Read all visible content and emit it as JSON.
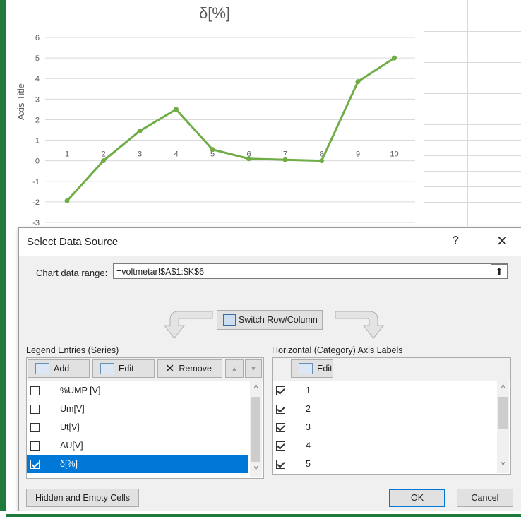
{
  "chart": {
    "title": "δ[%]",
    "axis_title": "Axis Title"
  },
  "chart_data": {
    "type": "line",
    "title": "δ[%]",
    "ylabel": "Axis Title",
    "xlabel": "",
    "categories": [
      "1",
      "2",
      "3",
      "4",
      "5",
      "6",
      "7",
      "8",
      "9",
      "10"
    ],
    "series": [
      {
        "values": [
          -1.95,
          0.0,
          1.45,
          2.5,
          0.55,
          0.1,
          0.05,
          0.0,
          3.85,
          5.0
        ],
        "color": "#70ad47"
      }
    ],
    "y_ticks": [
      "6",
      "5",
      "4",
      "3",
      "2",
      "1",
      "0",
      "-1",
      "-2",
      "-3"
    ],
    "ylim": [
      -3,
      6
    ],
    "grid": true
  },
  "dialog": {
    "title": "Select Data Source",
    "help": "?",
    "close": "✕",
    "chart_range_label": "Chart data range:",
    "chart_range_value": "=voltmetar!$A$1:$K$6",
    "collapse_icon": "⬆",
    "switch_label": "Switch Row/Column",
    "legend_label": "Legend Entries (Series)",
    "axis_labels_label": "Horizontal (Category) Axis Labels",
    "toolbar": {
      "add": "Add",
      "edit": "Edit",
      "remove": "Remove",
      "up": "▲",
      "down": "▼",
      "axis_edit": "Edit"
    },
    "series": [
      {
        "label": "%UMP [V]",
        "checked": false
      },
      {
        "label": "Um[V]",
        "checked": false
      },
      {
        "label": "Ut[V]",
        "checked": false
      },
      {
        "label": "ΔU[V]",
        "checked": false
      },
      {
        "label": "δ[%]",
        "checked": true
      }
    ],
    "categories": [
      {
        "label": "1",
        "checked": true
      },
      {
        "label": "2",
        "checked": true
      },
      {
        "label": "3",
        "checked": true
      },
      {
        "label": "4",
        "checked": true
      },
      {
        "label": "5",
        "checked": true
      }
    ],
    "hidden_cells": "Hidden and Empty Cells",
    "ok": "OK",
    "cancel": "Cancel",
    "scroll_up": "˄",
    "scroll_down": "˅"
  },
  "colors": {
    "excel_green": "#1f7a3b",
    "series_green": "#70ad47",
    "selection_blue": "#0078d7"
  }
}
